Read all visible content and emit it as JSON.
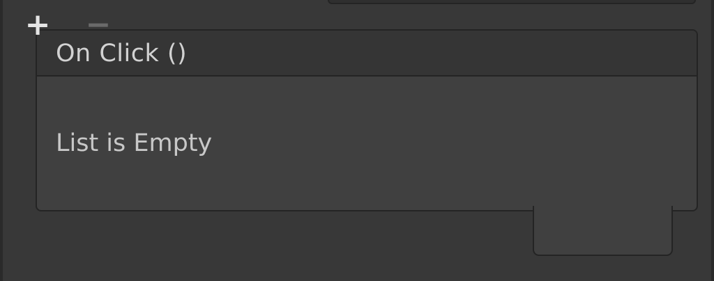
{
  "event": {
    "title": "On Click ()",
    "empty_text": "List is Empty"
  },
  "buttons": {
    "add_label": "+",
    "remove_label": "−"
  },
  "colors": {
    "background": "#383838",
    "panel_body": "#404040",
    "panel_header": "#353535",
    "border": "#242424",
    "text": "#d2d2d2",
    "disabled": "#6a6a6a"
  }
}
